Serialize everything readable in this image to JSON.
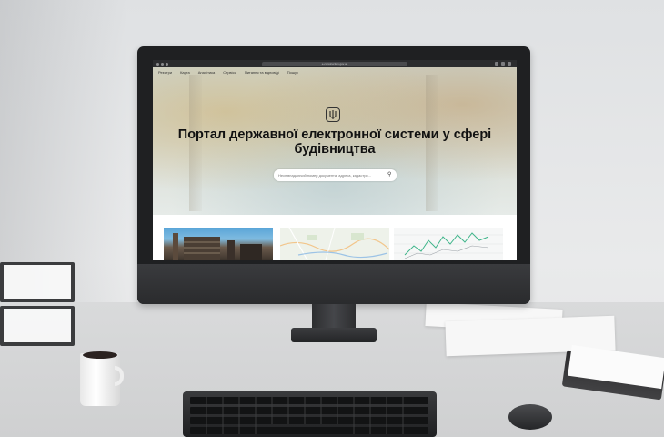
{
  "browser": {
    "url": "e-construction.gov.ua"
  },
  "site": {
    "nav": [
      "Реєстри",
      "Карта",
      "Аналітика",
      "Сервіси",
      "Питання та відповіді",
      "Пошук"
    ],
    "title": "Портал державної електронної системи у сфері будівництва",
    "search_placeholder": "Неспівпадаючий номер документа, адреса, кадастро..."
  },
  "colors": {
    "title": "#111111",
    "screen_bg": "#ffffff",
    "monitor": "#1f2022"
  }
}
